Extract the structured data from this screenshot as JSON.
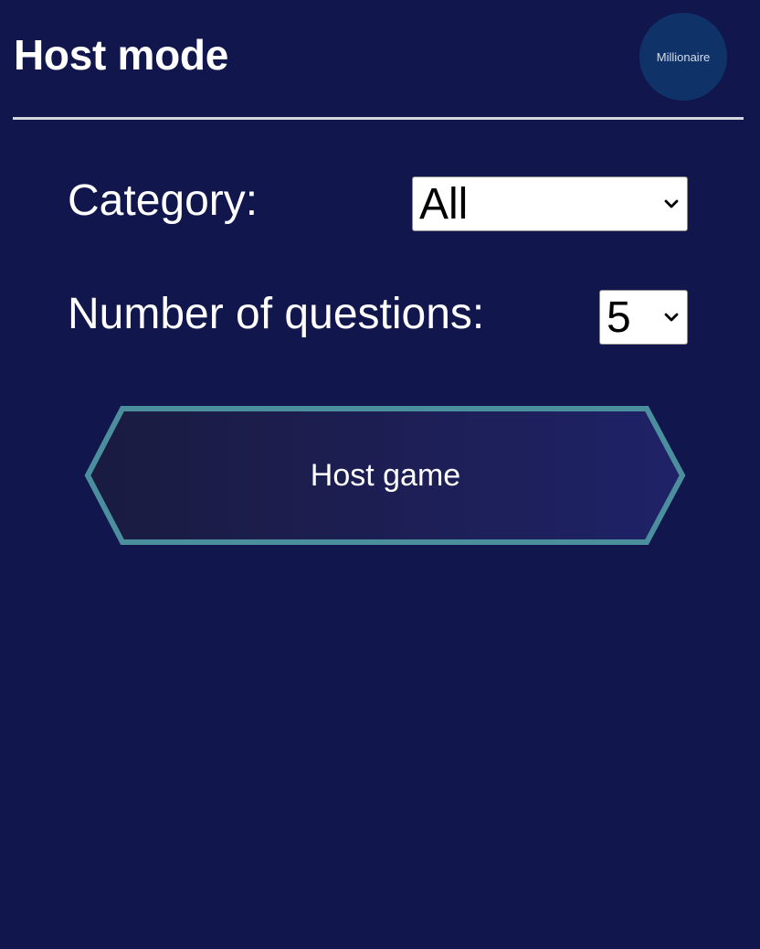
{
  "header": {
    "title": "Host mode",
    "logo_text": "Millionaire"
  },
  "form": {
    "category": {
      "label": "Category:",
      "selected": "All"
    },
    "question_count": {
      "label": "Number of questions:",
      "selected": "5"
    }
  },
  "actions": {
    "host_label": "Host game"
  },
  "colors": {
    "background": "#11174d",
    "logo_background": "#0f3268",
    "button_border": "#4b8f9f",
    "button_gradient_start": "#1a1b40",
    "button_gradient_end": "#1f2267",
    "divider": "#d4d6de"
  },
  "icons": {
    "select_arrow": "chevron-down-icon"
  }
}
